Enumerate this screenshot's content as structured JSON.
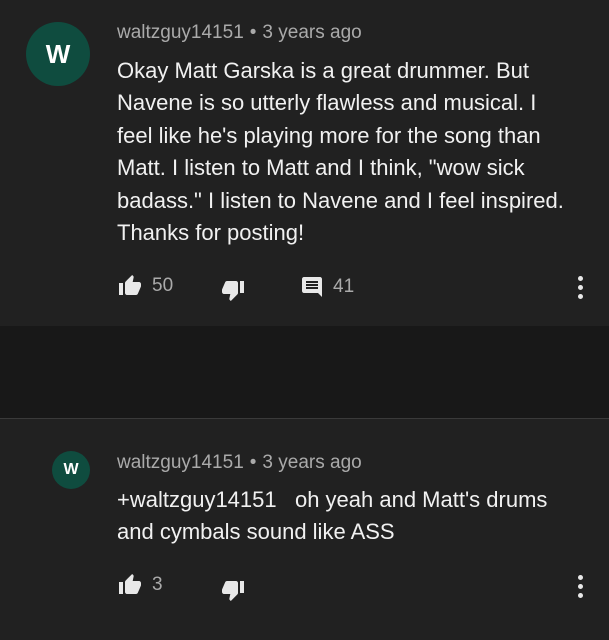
{
  "comments": [
    {
      "avatar_letter": "W",
      "author": "waltzguy14151",
      "separator": "•",
      "time": "3 years ago",
      "lines": [
        "Okay Matt Garska is a great drummer.  But",
        "Navene is so utterly flawless and musical.  I",
        "feel like he's playing more for the song than",
        "Matt.  I listen to Matt and I think, \"wow sick",
        "badass.\"  I listen to Navene and I feel inspired.",
        "Thanks for posting!"
      ],
      "likes": "50",
      "replies": "41",
      "icons": [
        "thumbs-up-icon",
        "thumbs-down-icon",
        "comment-icon",
        "more-vert-icon"
      ]
    },
    {
      "avatar_letter": "W",
      "author": "waltzguy14151",
      "separator": "•",
      "time": "3 years ago",
      "lines": [
        "+waltzguy14151   oh yeah and Matt's drums",
        "and cymbals sound like ASS"
      ],
      "likes": "3",
      "icons": [
        "thumbs-up-icon",
        "thumbs-down-icon",
        "more-vert-icon"
      ]
    }
  ],
  "colors": {
    "background": "#181818",
    "card": "#212121",
    "avatar": "#0f4c3f",
    "text": "#f1f1f1",
    "secondary_text": "#aaaaaa"
  }
}
